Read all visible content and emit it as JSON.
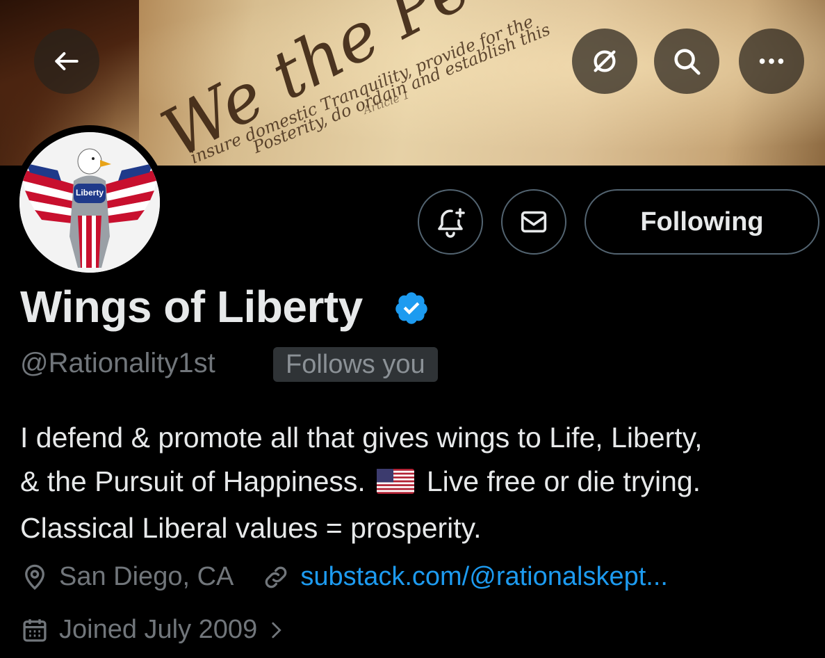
{
  "banner": {
    "script_big": "We the People",
    "script_line1": "insure domestic Tranquility, provide for the",
    "script_line2": "Posterity, do ordain and establish this",
    "script_line3": "Article 1",
    "script_line4": "",
    "script_line5": "",
    "script_line6": ""
  },
  "header": {
    "back_icon": "arrow-left-icon",
    "grok_icon": "grok-icon",
    "search_icon": "search-icon",
    "more_icon": "ellipsis-icon"
  },
  "avatar": {
    "badge_text": "Liberty"
  },
  "actions": {
    "notify_icon": "bell-plus-icon",
    "message_icon": "envelope-icon",
    "following_label": "Following"
  },
  "profile": {
    "display_name": "Wings of Liberty",
    "handle": "@Rationality1st",
    "follows_you": "Follows you",
    "bio_line1": "I defend & promote all that gives wings to Life, Liberty,",
    "bio_line2a": "& the Pursuit of Happiness.",
    "bio_line2b": "Live free or die trying.",
    "bio_line3": "Classical Liberal values = prosperity.",
    "location": "San Diego, CA",
    "website": "substack.com/@rationalskept...",
    "joined": "Joined July 2009"
  },
  "colors": {
    "link": "#1d9bf0",
    "verified": "#1d9bf0",
    "muted": "#71767b",
    "border": "#536471"
  }
}
